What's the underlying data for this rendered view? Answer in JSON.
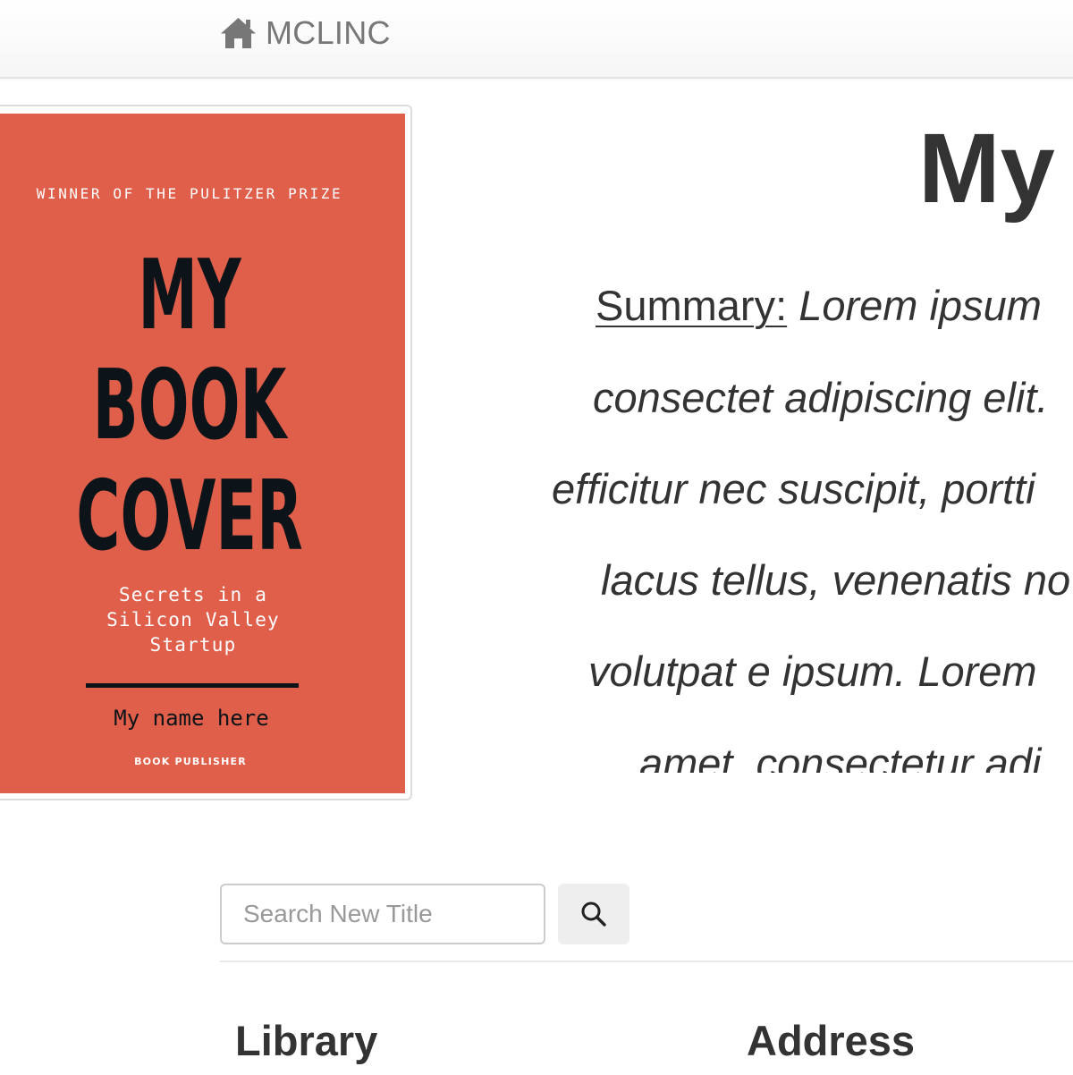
{
  "navbar": {
    "brand_icon": "home-icon",
    "brand_label": "MCLINC"
  },
  "book": {
    "cover": {
      "prize_line": "WINNER OF THE PULITZER PRIZE",
      "title_lines": [
        "MY",
        "BOOK",
        "COVER"
      ],
      "subtitle_lines": [
        "Secrets in a",
        "Silicon Valley",
        "Startup"
      ],
      "author": "My name here",
      "publisher": "BOOK PUBLISHER",
      "background_color": "#e05f4b"
    },
    "title": "My",
    "summary": {
      "label": "Summary:",
      "lines": [
        "Lorem ipsum",
        "consectet adipiscing elit.",
        "efficitur nec suscipit, portti",
        "lacus tellus, venenatis no",
        "volutpat e ipsum. Lorem",
        "amet, consectetur adi"
      ]
    }
  },
  "search": {
    "placeholder": "Search New Title",
    "value": "",
    "button_icon": "search-icon"
  },
  "table": {
    "headers": [
      "Library",
      "Address"
    ]
  },
  "colors": {
    "text": "#333333",
    "brand_text": "#777777",
    "search_button_bg": "#eeeeee"
  }
}
